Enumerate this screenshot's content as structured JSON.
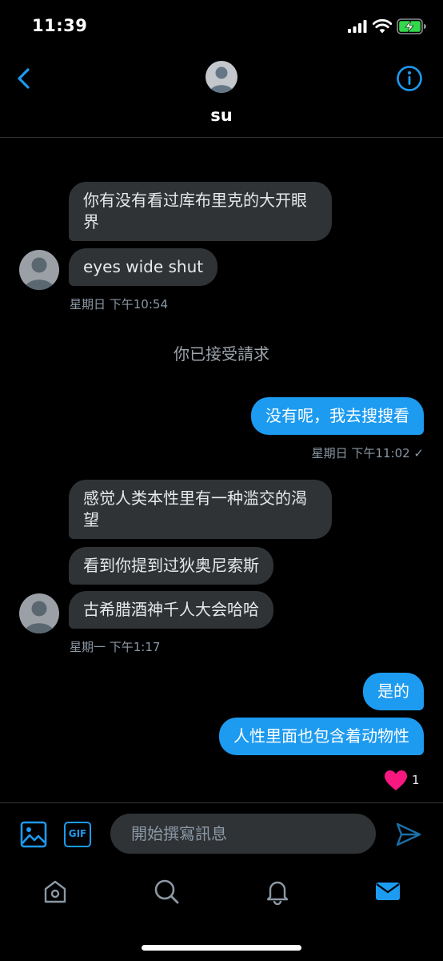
{
  "status_bar": {
    "time": "11:39"
  },
  "header": {
    "contact_name": "su"
  },
  "messages": {
    "m1": "你有没有看过库布里克的大开眼界",
    "m2": "eyes wide shut",
    "ts1": "星期日 下午10:54",
    "system_note": "你已接受請求",
    "m3": "没有呢，我去搜搜看",
    "ts2": "星期日 下午11:02 ✓",
    "m4": "感觉人类本性里有一种滥交的渴望",
    "m5": "看到你提到过狄奥尼索斯",
    "m6": "古希腊酒神千人大会哈哈",
    "ts3": "星期一 下午1:17",
    "m7": "是的",
    "m8": "人性里面也包含着动物性",
    "reaction_count": "1"
  },
  "composer": {
    "placeholder": "開始撰寫訊息",
    "gif_label": "GIF"
  },
  "colors": {
    "accent": "#1d9bf0",
    "incoming_bubble": "#2f3336",
    "background": "#000000",
    "heart": "#f91880"
  },
  "icons": {
    "tabs": [
      "home-icon",
      "search-icon",
      "notifications-icon",
      "messages-icon"
    ]
  }
}
